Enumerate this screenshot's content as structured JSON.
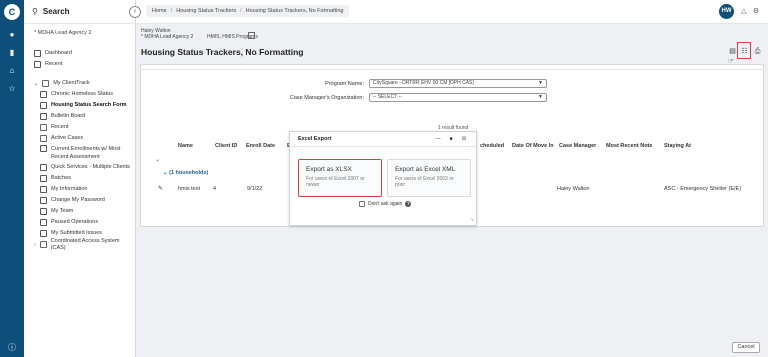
{
  "sidebar": {
    "search_label": "Search",
    "agency": "* MDHA Lead Agency 2",
    "items": [
      {
        "label": "Dashboard"
      },
      {
        "label": "Recent"
      },
      {
        "label": "My ClientTrack"
      },
      {
        "label": "Chronic Homeless Status"
      },
      {
        "label": "Housing Status Search Form"
      },
      {
        "label": "Bulletin Board"
      },
      {
        "label": "Recent"
      },
      {
        "label": "Active Cases"
      },
      {
        "label": "Current Enrollments w/ Most Recent Assessment"
      },
      {
        "label": "Quick Services - Multiple Clients"
      },
      {
        "label": "Batches"
      },
      {
        "label": "My Information"
      },
      {
        "label": "Change My Password"
      },
      {
        "label": "My Team"
      },
      {
        "label": "Paused Operations"
      },
      {
        "label": "My Submitted Issues"
      },
      {
        "label": "Coordinated Access System (CAS)"
      }
    ]
  },
  "breadcrumb": {
    "home": "Home",
    "level1": "Housing Status Trackers",
    "level2": "Housing Status Trackers, No Formatting"
  },
  "user": {
    "initials": "HW",
    "name": "Haley Walton",
    "agency": "* MDHA Lead Agency 2",
    "program": "HMIS, HMIS Programs"
  },
  "page_title": "Housing Status Trackers, No Formatting",
  "filters": {
    "program_label": "Program Name:",
    "program_value": "CitySquare - DRTRR EHV 00 CM [DPH CAS]",
    "org_label": "Case Manager's Organization:",
    "org_value": "-- SELECT --"
  },
  "results_text": "1 result found",
  "table": {
    "headers": [
      "Name",
      "Client ID",
      "Enroll Date",
      "Eli",
      "cheduled",
      "Date Of Move In",
      "Case Manager",
      "Most Recent Note",
      "Staying At"
    ],
    "group_label": "(1 households)",
    "row": {
      "name": "hmis test",
      "client_id": "4",
      "enroll_date": "9/1/22",
      "case_manager": "Haley Walton",
      "staying_at": "ASC - Emergency Shelter (E/E)"
    }
  },
  "modal": {
    "title": "Excel Export",
    "options": [
      {
        "title": "Export as XLSX",
        "desc": "For users of Excel 2007 or newer"
      },
      {
        "title": "Export as Excel XML",
        "desc": "For users of Excel 2003 or prior"
      }
    ],
    "dont_ask": "Don't ask again"
  },
  "cancel_label": "Cancel",
  "colors": {
    "brand": "#0d4f7a",
    "highlight": "#e03a3a"
  }
}
